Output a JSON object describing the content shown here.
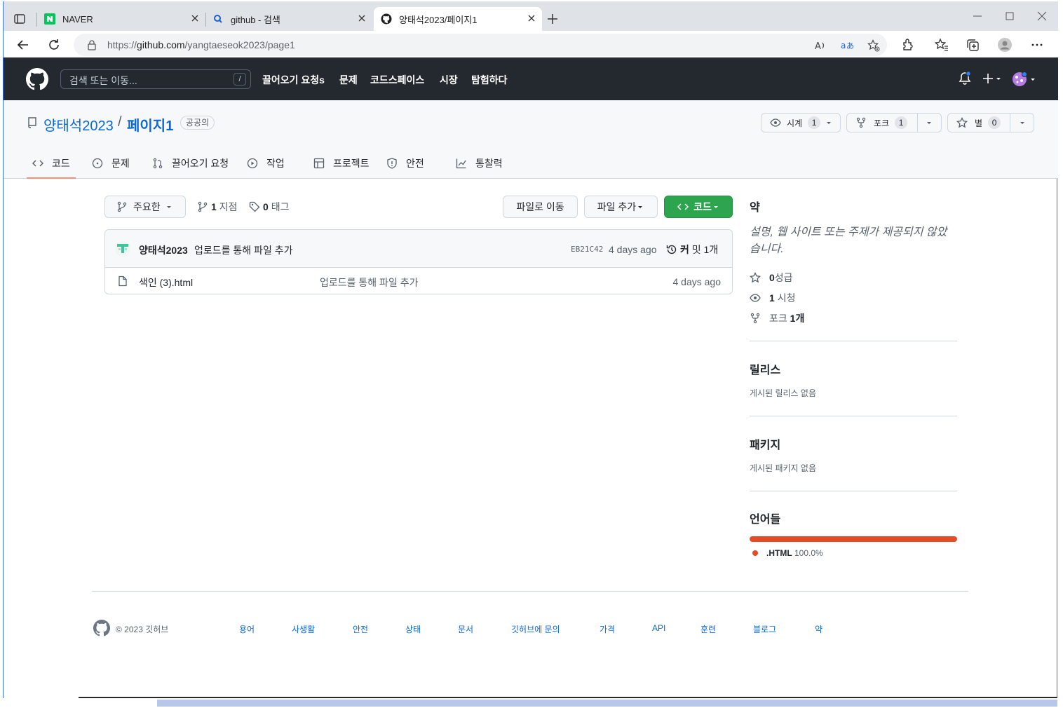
{
  "browser": {
    "tabs": [
      {
        "title": "NAVER",
        "favicon": "naver-icon"
      },
      {
        "title": "github - 검색",
        "favicon": "search-icon"
      },
      {
        "title": "양태석2023/페이지1",
        "favicon": "github-icon"
      }
    ],
    "url_prefix": "https://",
    "url_host": "github.com",
    "url_path": "/yangtaeseok2023/page1"
  },
  "gh_header": {
    "search_placeholder": "검색 또는 이동...",
    "search_shortcut": "/",
    "nav": [
      "끌어오기 요청s",
      "문제",
      "코드스페이스",
      "시장",
      "탐험하다"
    ]
  },
  "repo": {
    "owner": "양태석2023",
    "separator": "/",
    "name": "페이지1",
    "visibility": "공공의",
    "watch_label": "시계",
    "watch_count": "1",
    "fork_label": "포크",
    "fork_count": "1",
    "star_label": "별",
    "star_count": "0",
    "tabs": [
      "코드",
      "문제",
      "끌어오기 요청",
      "작업",
      "프로젝트",
      "안전",
      "통찰력"
    ]
  },
  "main": {
    "branch": "주요한",
    "branches_count": "1",
    "branches_label": "지점",
    "tags_count": "0",
    "tags_label": "태그",
    "goto_file": "파일로 이동",
    "add_file": "파일 추가",
    "code_btn": "코드",
    "commit": {
      "author": "양태석2023",
      "message": "업로드를 통해 파일 추가",
      "sha": "EB21C42",
      "time": "4 days ago",
      "commits_bold": "커",
      "commits_rest": "밋 1개"
    },
    "files": [
      {
        "name": "색인 (3).html",
        "message": "업로드를 통해 파일 추가",
        "time": "4 days ago"
      }
    ]
  },
  "sidebar": {
    "about_title": "약",
    "about_desc": "설명, 웹 사이트 또는 주제가 제공되지 않았습니다.",
    "stars_count": "0",
    "stars_label": "성급",
    "watching_count": "1",
    "watching_label": "시청",
    "forks_label": "포크",
    "forks_count": "1개",
    "releases_title": "릴리스",
    "releases_empty": "게시된 릴리스 없음",
    "packages_title": "패키지",
    "packages_empty": "게시된 패키지 없음",
    "languages_title": "언어들",
    "languages": [
      {
        "name": ".HTML",
        "percent": "100.0%",
        "color": "#e34c26"
      }
    ]
  },
  "footer": {
    "copyright": "© 2023 깃허브",
    "links": [
      "용어",
      "사생활",
      "안전",
      "상태",
      "문서",
      "깃허브에 문의",
      "가격",
      "API",
      "훈련",
      "블로그",
      "약"
    ]
  },
  "colors": {
    "accent_link": "#0969da",
    "green_button": "#2da44e",
    "header_bg": "#24292f",
    "tab_underline": "#fd8c73"
  }
}
